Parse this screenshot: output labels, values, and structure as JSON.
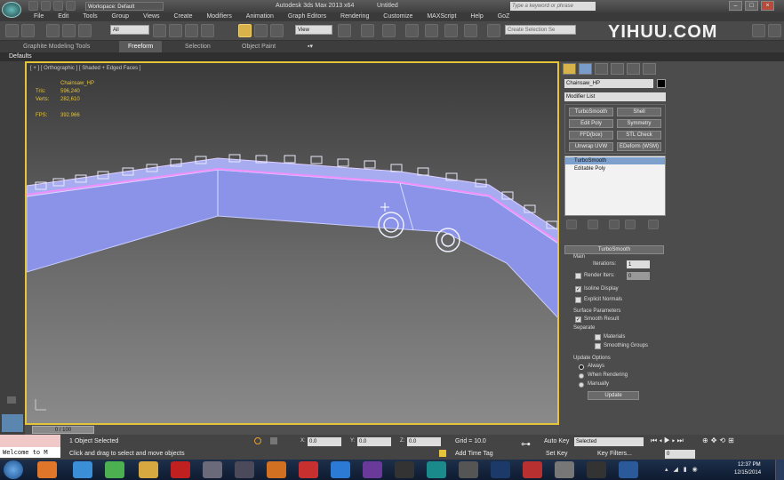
{
  "titlebar": {
    "workspace": "Workspace: Default",
    "app_title": "Autodesk 3ds Max  2013 x64",
    "doc_title": "Untitled",
    "search_placeholder": "Type a keyword or phrase"
  },
  "menu": [
    "File",
    "Edit",
    "Tools",
    "Group",
    "Views",
    "Create",
    "Modifiers",
    "Animation",
    "Graph Editors",
    "Rendering",
    "Customize",
    "MAXScript",
    "Help",
    "GoZ"
  ],
  "toolbar": {
    "filter_value": "All",
    "view_value": "View",
    "selection_set_placeholder": "Create Selection Se"
  },
  "watermark": "YIHUU.COM",
  "ribbon": {
    "tabs": [
      "Graphite Modeling Tools",
      "Freeform",
      "Selection",
      "Object Paint"
    ]
  },
  "defaults_label": "Defaults",
  "viewport": {
    "label": "[ + ] [ Orthographic ] [ Shaded + Edged Faces ]",
    "object_name": "Chainsaw_HP",
    "stats": [
      {
        "label": "Tris:",
        "value": "596,240"
      },
      {
        "label": "Verts:",
        "value": "282,610"
      }
    ],
    "fps_label": "FPS:",
    "fps_value": "392.966"
  },
  "command_panel": {
    "object_name": "Chainsaw_HP",
    "modifier_list": "Modifier List",
    "modifier_buttons": [
      "TurboSmooth",
      "Shell",
      "Edit Poly",
      "Symmetry",
      "FFD(box)",
      "STL Check",
      "Unwrap UVW",
      "EDeform (WSM)"
    ],
    "stack": [
      "TurboSmooth",
      "Editable Poly"
    ],
    "rollout_title": "TurboSmooth",
    "main_group": "Main",
    "iterations_label": "Iterations:",
    "iterations_value": "1",
    "render_iters_label": "Render Iters:",
    "render_iters_value": "0",
    "isoline_label": "Isoline Display",
    "explicit_label": "Explicit Normals",
    "surface_group": "Surface Parameters",
    "smooth_result_label": "Smooth Result",
    "separate_label": "Separate",
    "materials_label": "Materials",
    "smoothing_groups_label": "Smoothing Groups",
    "update_group": "Update Options",
    "always_label": "Always",
    "when_rendering_label": "When Rendering",
    "manually_label": "Manually",
    "update_button": "Update"
  },
  "timeline": {
    "frame": "0 / 100"
  },
  "status": {
    "welcome": "Welcome to M",
    "selected": "1 Object Selected",
    "prompt": "Click and drag to select and move objects",
    "x_value": "0.0",
    "y_value": "0.0",
    "z_value": "0.0",
    "grid": "Grid = 10.0",
    "add_time_tag": "Add Time Tag",
    "auto_key": "Auto Key",
    "set_key": "Set Key",
    "selected_dropdown": "Selected",
    "key_filters": "Key Filters...",
    "frame_field": "0"
  },
  "taskbar": {
    "time": "12:37 PM",
    "date": "12/15/2014"
  }
}
